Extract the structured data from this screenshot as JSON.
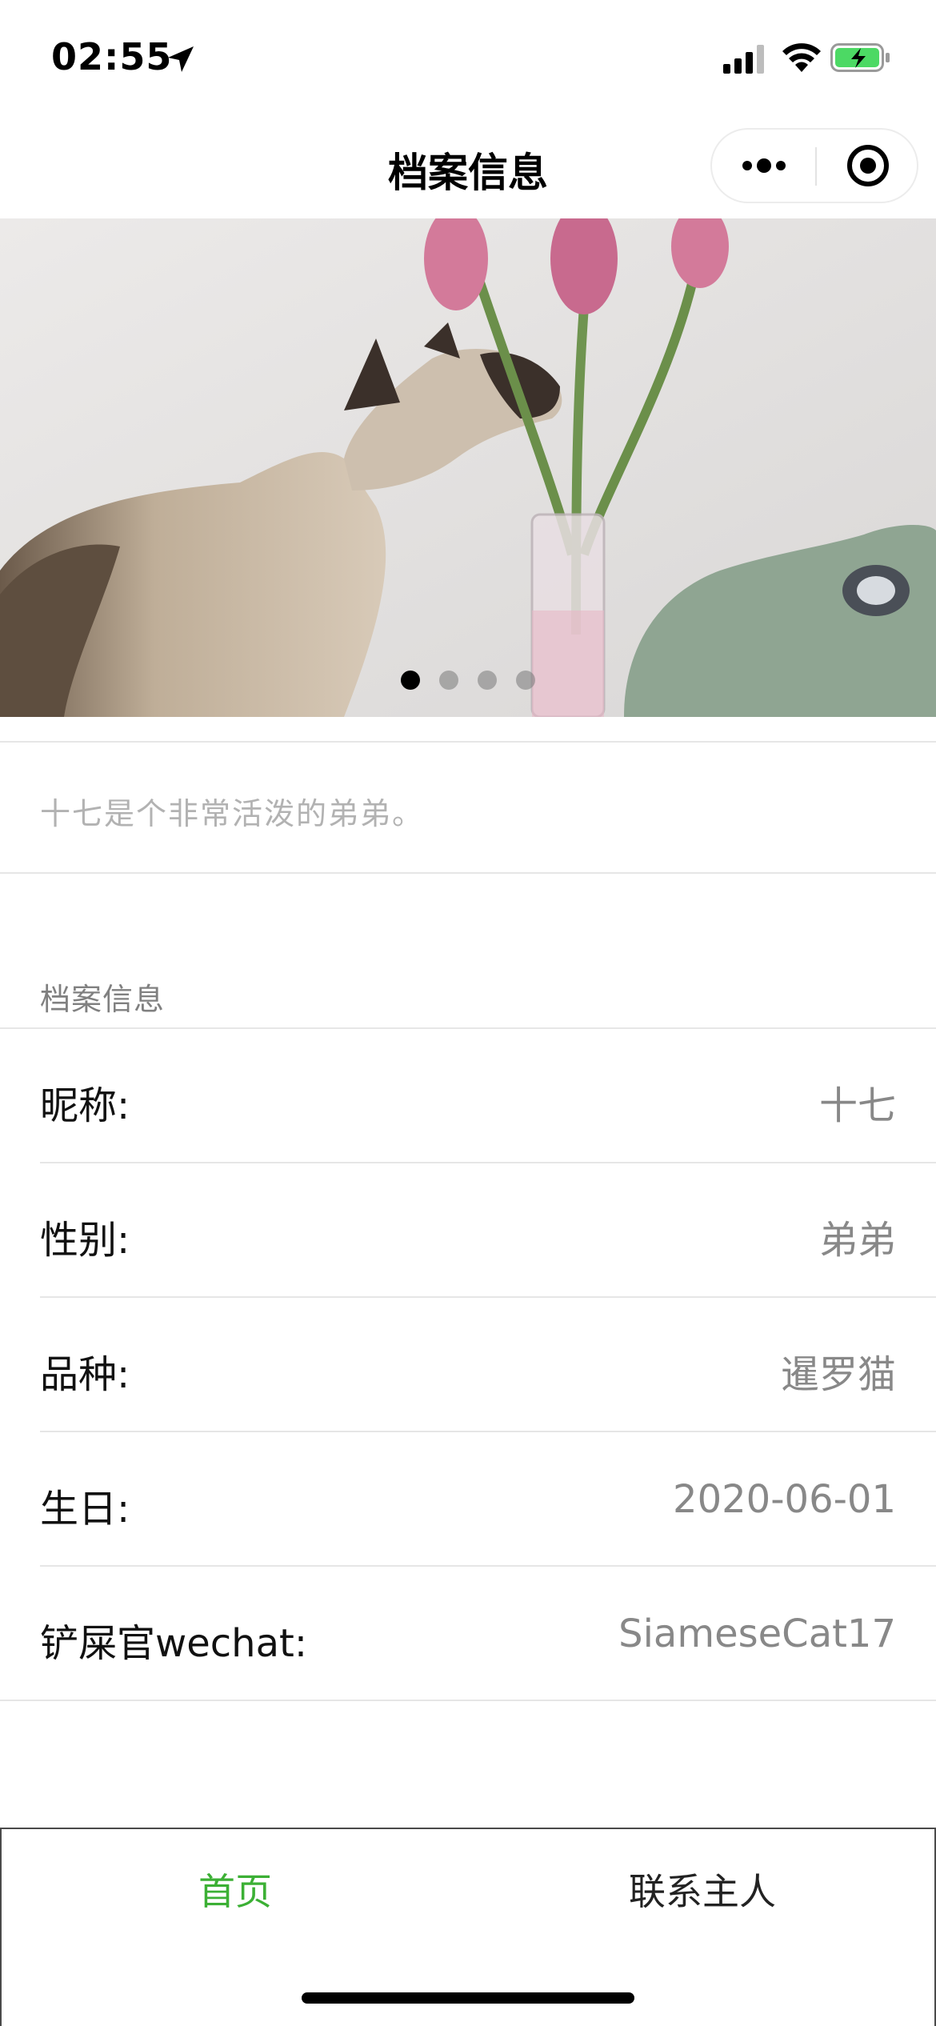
{
  "status_bar": {
    "time": "02:55",
    "icons": [
      "location-arrow-icon",
      "signal-icon",
      "wifi-icon",
      "battery-charging-icon"
    ],
    "battery_color": "#4cd964"
  },
  "nav": {
    "title": "档案信息",
    "more_icon": "more-dots-icon",
    "close_icon": "target-close-icon"
  },
  "banner": {
    "slide_count": 4,
    "active_index": 0
  },
  "description": "十七是个非常活泼的弟弟。",
  "profile": {
    "section_title": "档案信息",
    "rows": [
      {
        "label": "昵称:",
        "value": "十七"
      },
      {
        "label": "性别:",
        "value": "弟弟"
      },
      {
        "label": "品种:",
        "value": "暹罗猫"
      },
      {
        "label": "生日:",
        "value": "2020-06-01"
      },
      {
        "label": "铲屎官wechat:",
        "value": "SiameseCat17"
      }
    ]
  },
  "tab_bar": {
    "tabs": [
      {
        "label": "首页",
        "active": true
      },
      {
        "label": "联系主人",
        "active": false
      }
    ],
    "active_color": "#3cb035"
  }
}
